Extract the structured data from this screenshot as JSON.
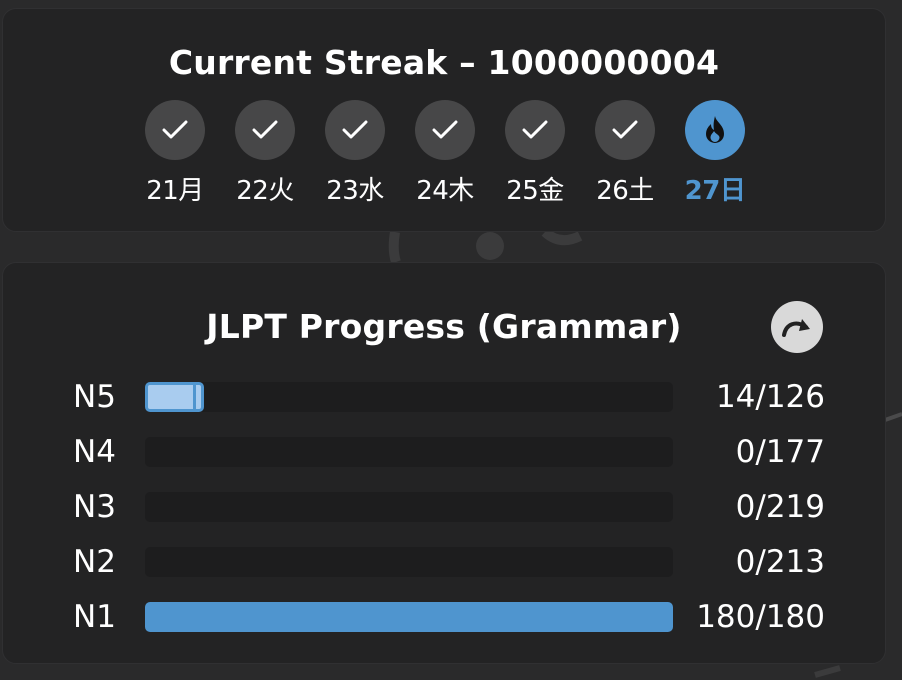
{
  "streak": {
    "title": "Current Streak – 1000000004",
    "days": [
      {
        "label": "21月",
        "status": "done",
        "icon": "check-icon"
      },
      {
        "label": "22火",
        "status": "done",
        "icon": "check-icon"
      },
      {
        "label": "23水",
        "status": "done",
        "icon": "check-icon"
      },
      {
        "label": "24木",
        "status": "done",
        "icon": "check-icon"
      },
      {
        "label": "25金",
        "status": "done",
        "icon": "check-icon"
      },
      {
        "label": "26土",
        "status": "done",
        "icon": "check-icon"
      },
      {
        "label": "27日",
        "status": "today",
        "icon": "flame-icon"
      }
    ]
  },
  "jlpt": {
    "title": "JLPT Progress (Grammar)",
    "refresh_icon": "refresh-icon",
    "levels": [
      {
        "label": "N5",
        "done": 14,
        "total": 126,
        "count": "14/126"
      },
      {
        "label": "N4",
        "done": 0,
        "total": 177,
        "count": "0/177"
      },
      {
        "label": "N3",
        "done": 0,
        "total": 219,
        "count": "0/219"
      },
      {
        "label": "N2",
        "done": 0,
        "total": 213,
        "count": "0/213"
      },
      {
        "label": "N1",
        "done": 180,
        "total": 180,
        "count": "180/180"
      }
    ]
  },
  "colors": {
    "accent": "#4f95cf",
    "accent_light": "#a9ccef",
    "card": "#232324",
    "circle": "#474748"
  }
}
